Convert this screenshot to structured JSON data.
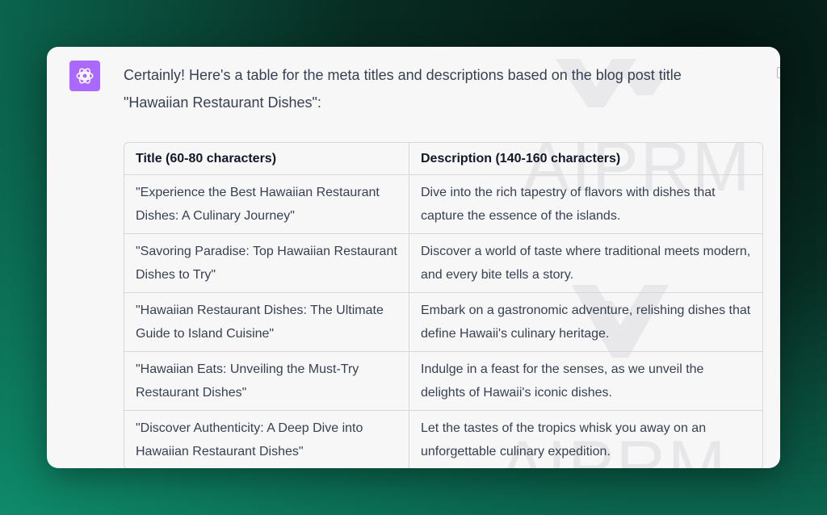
{
  "chat": {
    "assistant_avatar_icon": "openai-logo-icon",
    "avatar_color": "#ab68ff",
    "message_line1": "Certainly! Here's a table for the meta titles and descriptions based on the blog post title",
    "message_line2": "\"Hawaiian Restaurant Dishes\":"
  },
  "watermark": {
    "text": "AIPRM"
  },
  "table": {
    "headers": [
      "Title (60-80 characters)",
      "Description (140-160 characters)"
    ],
    "rows": [
      [
        "\"Experience the Best Hawaiian Restaurant Dishes: A Culinary Journey\"",
        "Dive into the rich tapestry of flavors with dishes that capture the essence of the islands."
      ],
      [
        "\"Savoring Paradise: Top Hawaiian Restaurant Dishes to Try\"",
        "Discover a world of taste where traditional meets modern, and every bite tells a story."
      ],
      [
        "\"Hawaiian Restaurant Dishes: The Ultimate Guide to Island Cuisine\"",
        "Embark on a gastronomic adventure, relishing dishes that define Hawaii's culinary heritage."
      ],
      [
        "\"Hawaiian Eats: Unveiling the Must-Try Restaurant Dishes\"",
        "Indulge in a feast for the senses, as we unveil the delights of Hawaii's iconic dishes."
      ],
      [
        "\"Discover Authenticity: A Deep Dive into Hawaiian Restaurant Dishes\"",
        "Let the tastes of the tropics whisk you away on an unforgettable culinary expedition."
      ]
    ]
  }
}
